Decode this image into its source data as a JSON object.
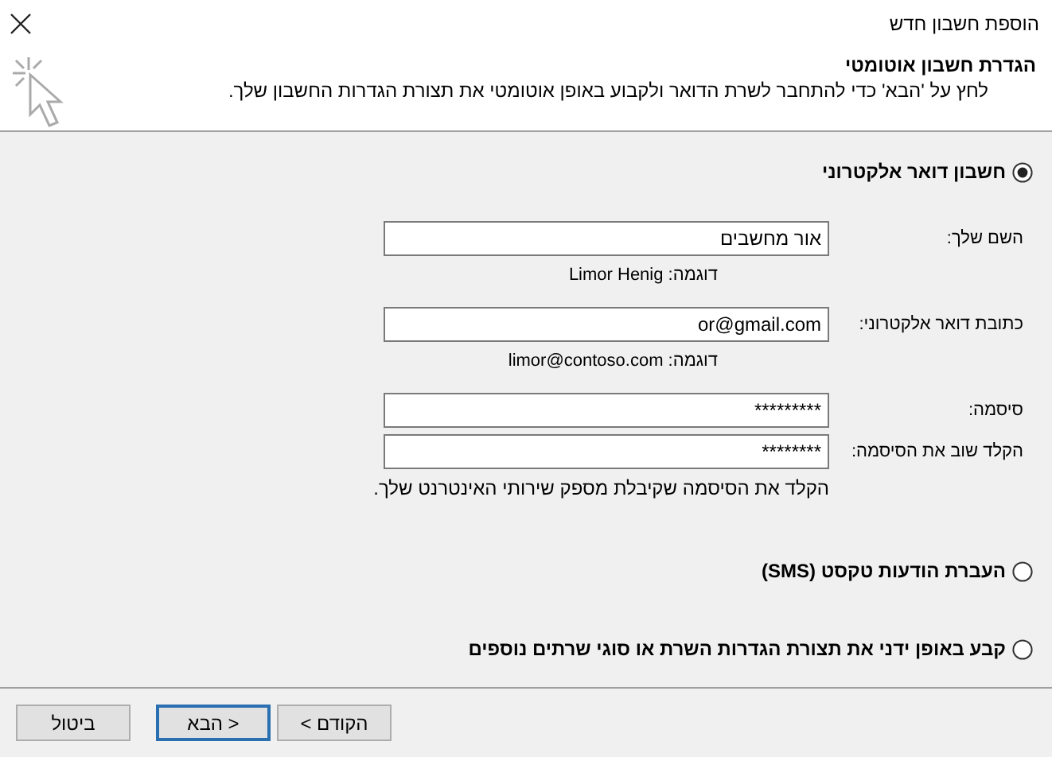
{
  "window": {
    "title": "הוספת חשבון חדש"
  },
  "header": {
    "title": "הגדרת חשבון אוטומטי",
    "description": "לחץ על 'הבא' כדי להתחבר לשרת הדואר ולקבוע באופן אוטומטי את תצורת הגדרות החשבון שלך."
  },
  "options": [
    {
      "label": "חשבון דואר אלקטרוני",
      "selected": true,
      "fields": [
        {
          "label": "השם שלך:",
          "value": "אור מחשבים",
          "hint": "דוגמה: Limor Henig"
        },
        {
          "label": "כתובת דואר אלקטרוני:",
          "value": "or@gmail.com",
          "hint": "דוגמה: limor@contoso.com"
        },
        {
          "label": "סיסמה:",
          "value": "*********"
        },
        {
          "label": "הקלד שוב את הסיסמה:",
          "value": "********"
        }
      ],
      "note": "הקלד את הסיסמה שקיבלת מספק שירותי האינטרנט שלך."
    },
    {
      "label": "העברת הודעות טקסט (SMS)",
      "selected": false
    },
    {
      "label": "קבע באופן ידני את תצורת הגדרות השרת או סוגי שרתים נוספים",
      "selected": false
    }
  ],
  "buttons": [
    {
      "label": "הקודם >",
      "default": false
    },
    {
      "label": "< הבא",
      "default": true
    },
    {
      "label": "ביטול",
      "default": false
    }
  ]
}
